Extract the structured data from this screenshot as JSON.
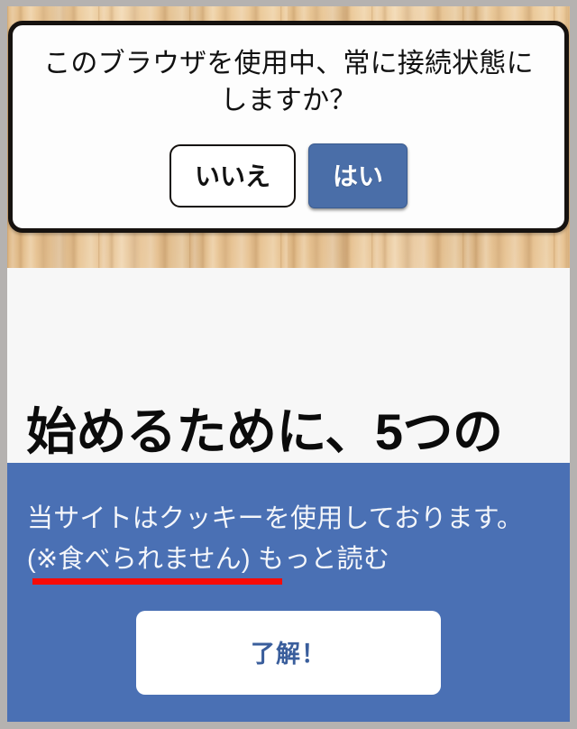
{
  "dialog": {
    "message": "このブラウザを使用中、常に接続状態にしますか？",
    "no_label": "いいえ",
    "yes_label": "はい",
    "yes_color": "#4a6ea8",
    "border_color": "#16120f"
  },
  "page": {
    "heading": "始めるために、5つの",
    "background_color": "#f7f7f7"
  },
  "cookie_banner": {
    "background_color": "#4a70b4",
    "text_part1": "当サイトはクッキーを使用しております。",
    "text_underlined": "(※食べられません)",
    "text_spacer": " ",
    "more_link": "もっと読む",
    "underline_color": "#f60b08",
    "accept_label": "了解！",
    "accept_text_color": "#3a5e9c"
  },
  "chrome": {
    "frame_color": "#b5b2b0",
    "wood_color": "#e7c293"
  }
}
